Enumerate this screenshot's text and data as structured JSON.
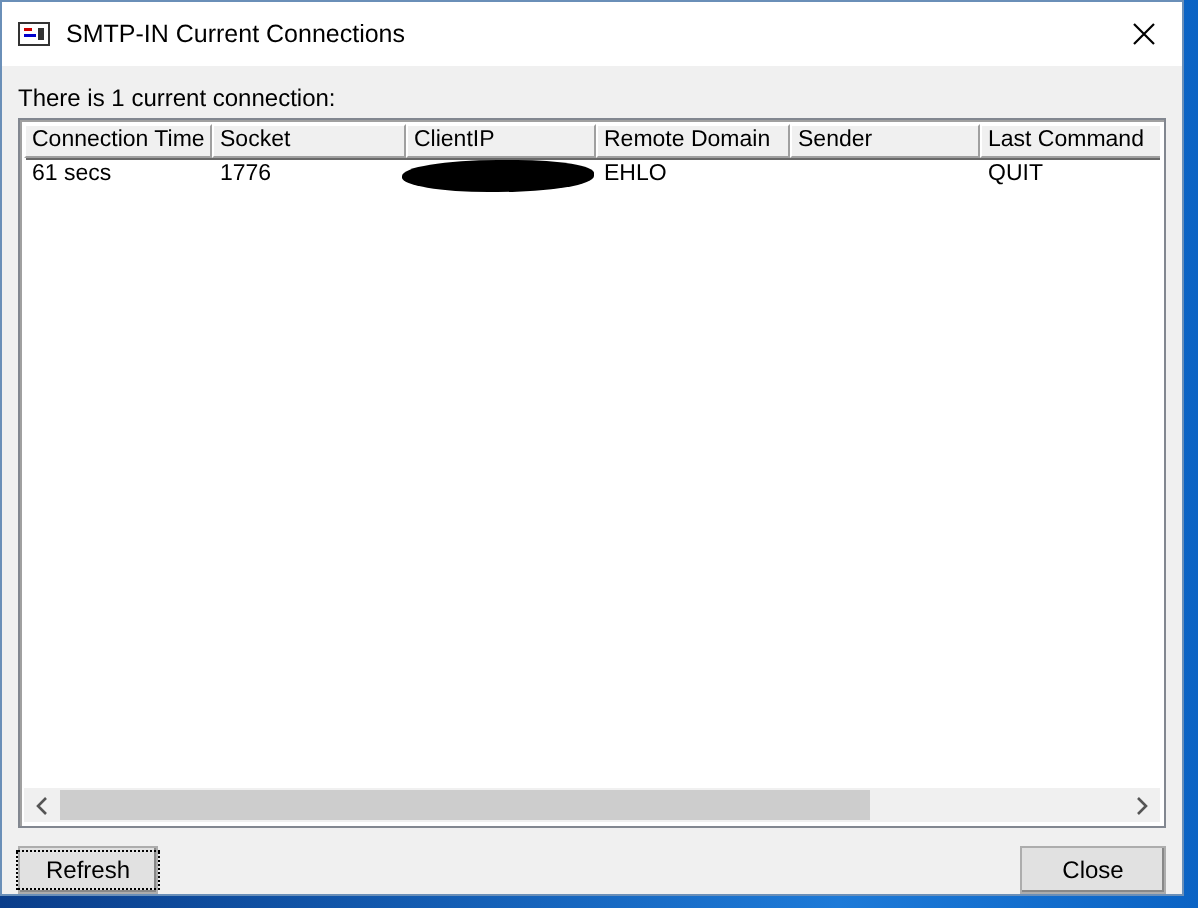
{
  "window": {
    "title": "SMTP-IN Current Connections"
  },
  "summary": "There is 1 current connection:",
  "table": {
    "columns": [
      "Connection Time",
      "Socket",
      "ClientIP",
      "Remote Domain",
      "Sender",
      "Last Command"
    ],
    "rows": [
      {
        "cells": [
          "61 secs",
          "1776",
          null,
          "EHLO",
          "",
          "QUIT"
        ],
        "redacted": [
          false,
          false,
          true,
          false,
          false,
          false
        ]
      }
    ]
  },
  "buttons": [
    {
      "label": "Refresh",
      "focused": true
    },
    {
      "label": "Close",
      "focused": false
    }
  ]
}
